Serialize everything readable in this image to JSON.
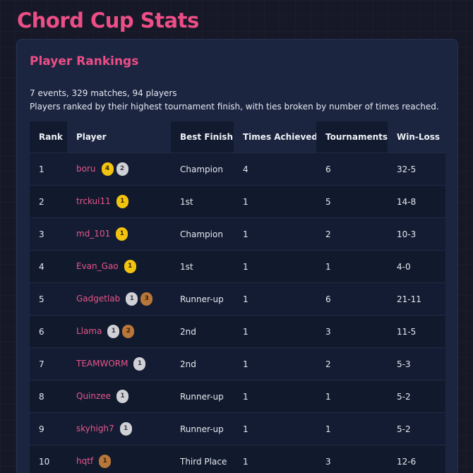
{
  "page": {
    "title": "Chord Cup Stats"
  },
  "rankings": {
    "title": "Player Rankings",
    "summary": "7 events, 329 matches, 94 players",
    "description": "Players ranked by their highest tournament finish, with ties broken by number of times reached.",
    "columns": [
      "Rank",
      "Player",
      "Best Finish",
      "Times Achieved",
      "Tournaments",
      "Win-Loss"
    ],
    "rows": [
      {
        "rank": "1",
        "player": "boru",
        "badges": [
          {
            "medal": "gold",
            "count": "4"
          },
          {
            "medal": "silver",
            "count": "2"
          }
        ],
        "best_finish": "Champion",
        "times_achieved": "4",
        "tournaments": "6",
        "win_loss": "32-5"
      },
      {
        "rank": "2",
        "player": "trckui11",
        "badges": [
          {
            "medal": "gold",
            "count": "1"
          }
        ],
        "best_finish": "1st",
        "times_achieved": "1",
        "tournaments": "5",
        "win_loss": "14-8"
      },
      {
        "rank": "3",
        "player": "md_101",
        "badges": [
          {
            "medal": "gold",
            "count": "1"
          }
        ],
        "best_finish": "Champion",
        "times_achieved": "1",
        "tournaments": "2",
        "win_loss": "10-3"
      },
      {
        "rank": "4",
        "player": "Evan_Gao",
        "badges": [
          {
            "medal": "gold",
            "count": "1"
          }
        ],
        "best_finish": "1st",
        "times_achieved": "1",
        "tournaments": "1",
        "win_loss": "4-0"
      },
      {
        "rank": "5",
        "player": "Gadgetlab",
        "badges": [
          {
            "medal": "silver",
            "count": "1"
          },
          {
            "medal": "bronze",
            "count": "3"
          }
        ],
        "best_finish": "Runner-up",
        "times_achieved": "1",
        "tournaments": "6",
        "win_loss": "21-11"
      },
      {
        "rank": "6",
        "player": "Llama",
        "badges": [
          {
            "medal": "silver",
            "count": "1"
          },
          {
            "medal": "bronze",
            "count": "2"
          }
        ],
        "best_finish": "2nd",
        "times_achieved": "1",
        "tournaments": "3",
        "win_loss": "11-5"
      },
      {
        "rank": "7",
        "player": "TEAMWORM",
        "badges": [
          {
            "medal": "silver",
            "count": "1"
          }
        ],
        "best_finish": "2nd",
        "times_achieved": "1",
        "tournaments": "2",
        "win_loss": "5-3"
      },
      {
        "rank": "8",
        "player": "Quinzee",
        "badges": [
          {
            "medal": "silver",
            "count": "1"
          }
        ],
        "best_finish": "Runner-up",
        "times_achieved": "1",
        "tournaments": "1",
        "win_loss": "5-2"
      },
      {
        "rank": "9",
        "player": "skyhigh7",
        "badges": [
          {
            "medal": "silver",
            "count": "1"
          }
        ],
        "best_finish": "Runner-up",
        "times_achieved": "1",
        "tournaments": "1",
        "win_loss": "5-2"
      },
      {
        "rank": "10",
        "player": "hqtf",
        "badges": [
          {
            "medal": "bronze",
            "count": "1"
          }
        ],
        "best_finish": "Third Place",
        "times_achieved": "1",
        "tournaments": "3",
        "win_loss": "12-6"
      }
    ]
  },
  "colors": {
    "accent": "#ec4e86",
    "background": "#161827",
    "card": "#1b2540",
    "gold": "#f2c30f",
    "silver": "#cfd1d6",
    "bronze": "#b8773a"
  }
}
